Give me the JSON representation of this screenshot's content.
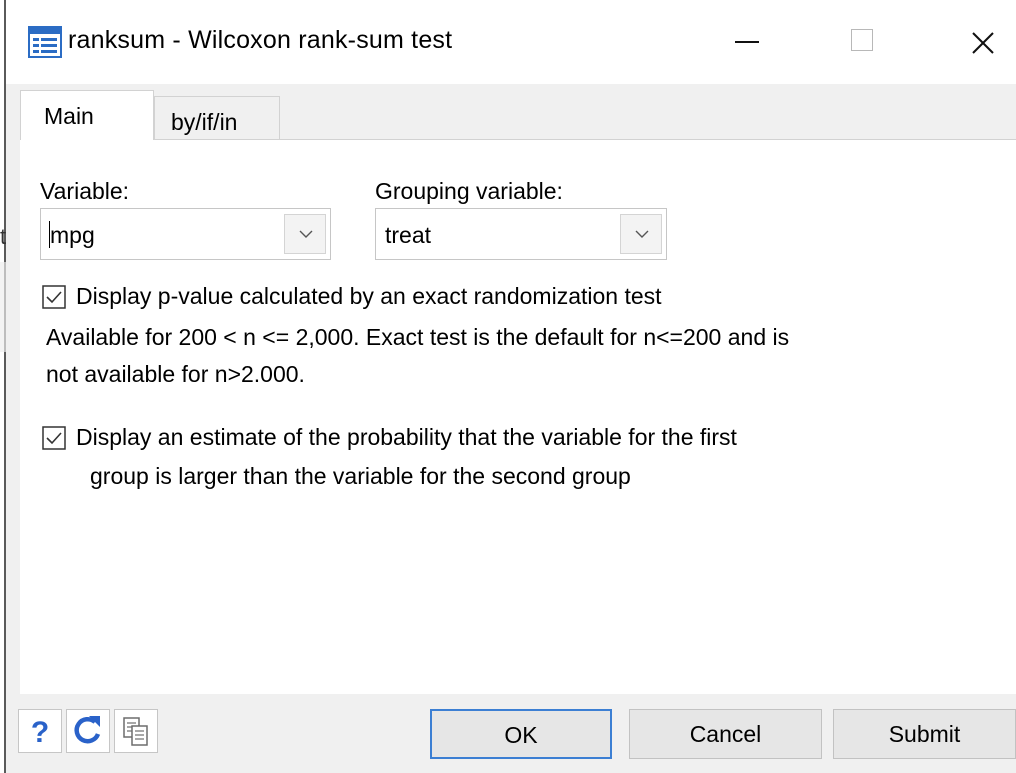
{
  "window": {
    "title": "ranksum - Wilcoxon rank-sum test",
    "controls": [
      "minimize",
      "maximize",
      "close"
    ]
  },
  "background_fragment": "t",
  "tabs": [
    {
      "label": "Main",
      "selected": true
    },
    {
      "label": "by/if/in",
      "selected": false
    }
  ],
  "main": {
    "variable": {
      "label": "Variable:",
      "value": "mpg"
    },
    "grouping": {
      "label": "Grouping variable:",
      "value": "treat"
    },
    "exact_option": {
      "checked": true,
      "label": "Display p-value calculated by an exact randomization test",
      "note_line1": "Available for 200 < n <= 2,000.  Exact test is the default for n<=200 and is",
      "note_line2": "not available for n>2.000."
    },
    "porder_option": {
      "checked": true,
      "label_line1": "Display an estimate of the probability that the variable for the first",
      "label_line2": "group is larger than the variable for the second group"
    }
  },
  "footer": {
    "icons": [
      "help-icon",
      "reset-icon",
      "copy-command-icon"
    ],
    "help_glyph": "?",
    "ok_label": "OK",
    "cancel_label": "Cancel",
    "submit_label": "Submit"
  },
  "colors": {
    "accent": "#3c7fd3",
    "help_blue": "#2a62c9",
    "button_face": "#e6e6e6",
    "dialog_bg": "#f0f0f0"
  }
}
